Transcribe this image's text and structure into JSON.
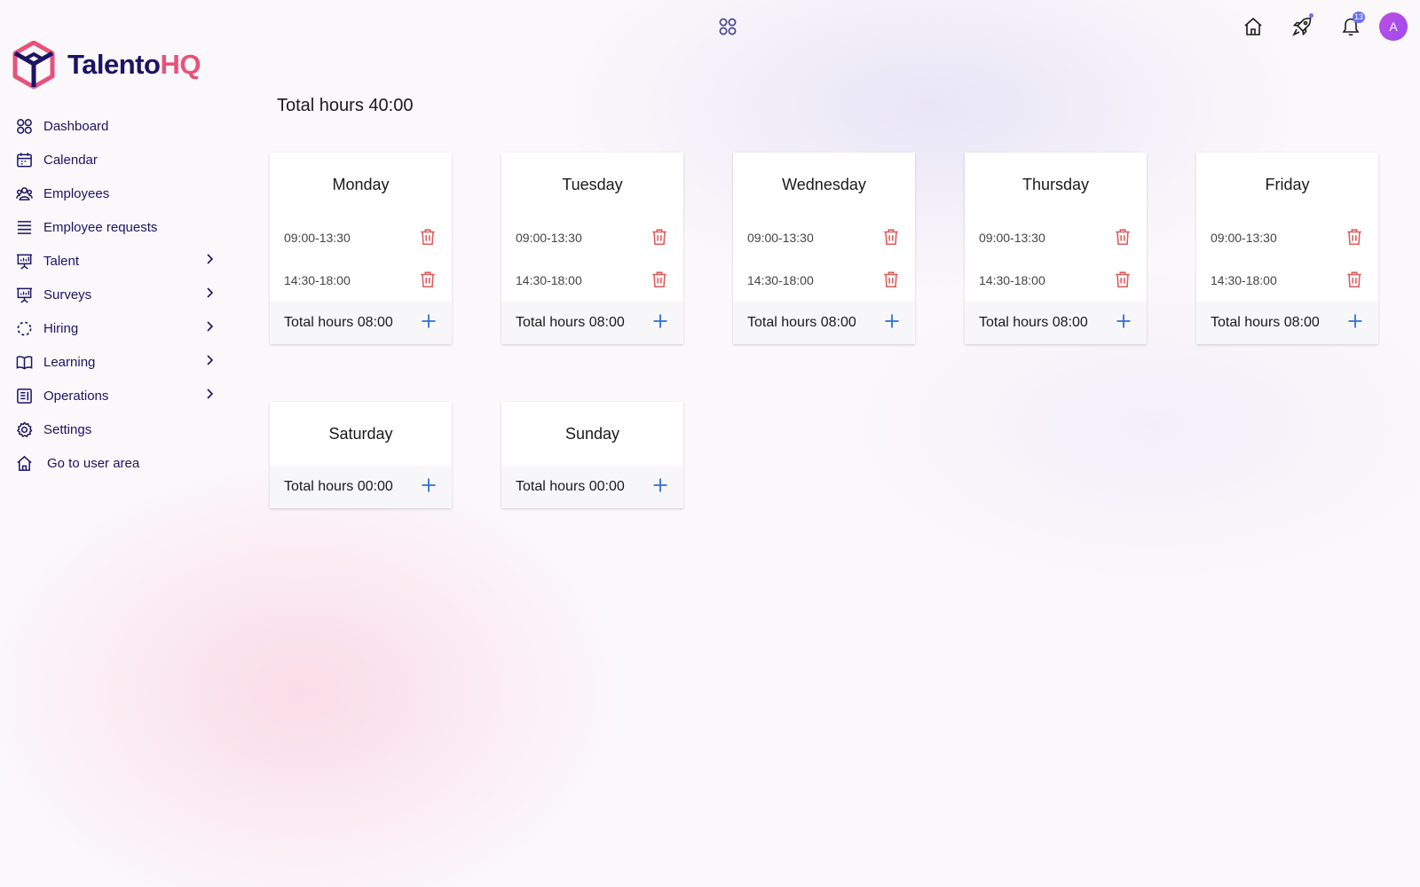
{
  "brand": {
    "name_part1": "Talento",
    "name_part2": "HQ",
    "color_primary": "#1b1464",
    "color_accent": "#e8527a"
  },
  "sidebar": {
    "items": [
      {
        "label": "Dashboard",
        "icon": "dashboard-icon",
        "expandable": false
      },
      {
        "label": "Calendar",
        "icon": "calendar-icon",
        "expandable": false
      },
      {
        "label": "Employees",
        "icon": "employees-icon",
        "expandable": false
      },
      {
        "label": "Employee requests",
        "icon": "list-icon",
        "expandable": false
      },
      {
        "label": "Talent",
        "icon": "presentation-icon",
        "expandable": true
      },
      {
        "label": "Surveys",
        "icon": "presentation-icon",
        "expandable": true
      },
      {
        "label": "Hiring",
        "icon": "dashed-circle-icon",
        "expandable": true
      },
      {
        "label": "Learning",
        "icon": "book-icon",
        "expandable": true
      },
      {
        "label": "Operations",
        "icon": "document-icon",
        "expandable": true
      },
      {
        "label": "Settings",
        "icon": "gear-icon",
        "expandable": false
      },
      {
        "label": "Go to user area",
        "icon": "home-icon",
        "expandable": false
      }
    ]
  },
  "topbar": {
    "apps_icon": "apps-grid-icon",
    "icons": [
      "home-icon",
      "rocket-icon",
      "bell-icon"
    ],
    "notification_count": "13",
    "avatar_initial": "A",
    "badge_color": "#6b6ff5"
  },
  "schedule": {
    "total": "Total hours 40:00",
    "days": [
      {
        "name": "Monday",
        "slots": [
          "09:00-13:30",
          "14:30-18:00"
        ],
        "total": "Total hours 08:00"
      },
      {
        "name": "Tuesday",
        "slots": [
          "09:00-13:30",
          "14:30-18:00"
        ],
        "total": "Total hours 08:00"
      },
      {
        "name": "Wednesday",
        "slots": [
          "09:00-13:30",
          "14:30-18:00"
        ],
        "total": "Total hours 08:00"
      },
      {
        "name": "Thursday",
        "slots": [
          "09:00-13:30",
          "14:30-18:00"
        ],
        "total": "Total hours 08:00"
      },
      {
        "name": "Friday",
        "slots": [
          "09:00-13:30",
          "14:30-18:00"
        ],
        "total": "Total hours 08:00"
      },
      {
        "name": "Saturday",
        "slots": [],
        "total": "Total hours 00:00"
      },
      {
        "name": "Sunday",
        "slots": [],
        "total": "Total hours 00:00"
      }
    ],
    "trash_color": "#e05a5a",
    "plus_color": "#2f6fd6"
  }
}
